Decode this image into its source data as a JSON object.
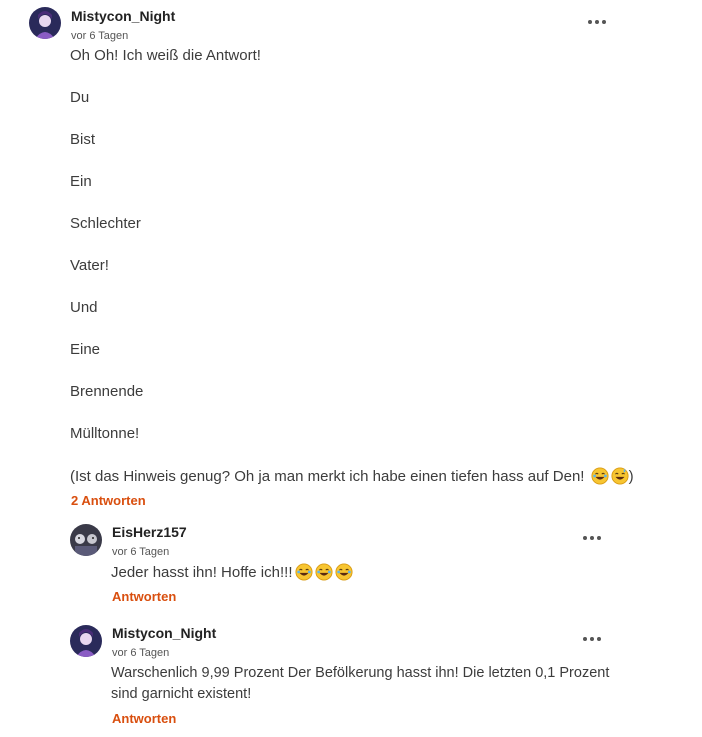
{
  "main_comment": {
    "username": "Mistycon_Night",
    "time": "vor 6 Tagen",
    "lines": [
      "Oh Oh! Ich weiß die Antwort!",
      "Du",
      "Bist",
      "Ein",
      "Schlechter",
      "Vater!",
      "Und",
      "Eine",
      "Brennende",
      "Mülltonne!"
    ],
    "last_line_start": "(Ist das Hinweis genug? Oh ja man merkt ich habe einen tiefen hass auf Den! ",
    "last_line_end": ")",
    "replies_count_label": "2 Antworten",
    "more_icon": "more-horizontal-icon"
  },
  "replies": [
    {
      "username": "EisHerz157",
      "time": "vor 6 Tagen",
      "text": "Jeder hasst ihn! Hoffe ich!!!",
      "reply_label": "Antworten",
      "emoji_count": 3
    },
    {
      "username": "Mistycon_Night",
      "time": "vor 6 Tagen",
      "text_line_1": "Warschenlich 9,99 Prozent Der Befölkerung hasst ihn! Die letzten 0,1 Prozent",
      "text_line_2": "sind garnicht existent!",
      "reply_label": "Antworten"
    }
  ],
  "colors": {
    "accent": "#d94f0f",
    "text": "#3c3c3c",
    "username": "#222222"
  }
}
